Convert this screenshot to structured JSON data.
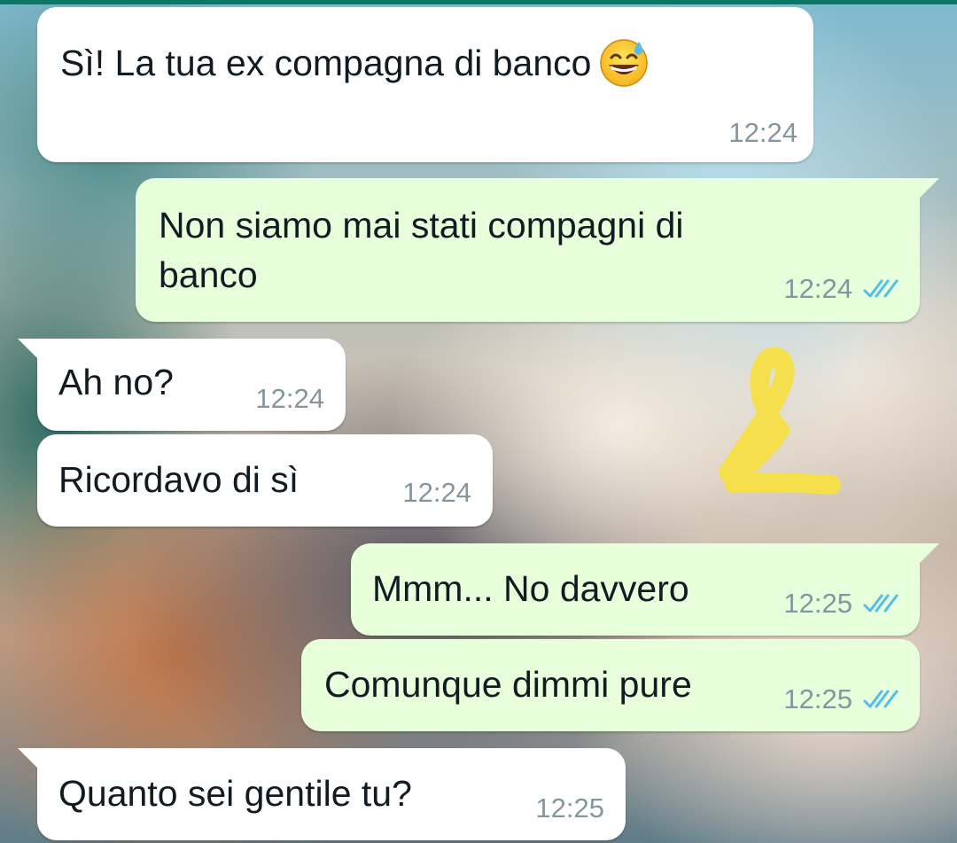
{
  "chat": {
    "messages": [
      {
        "text": "Sì! La tua ex compagna di banco",
        "emoji": "grinning-face-with-sweat",
        "time": "12:24",
        "direction": "incoming"
      },
      {
        "text_line1": "Non siamo mai stati compagni di",
        "text_line2": "banco",
        "time": "12:24",
        "direction": "outgoing",
        "status": "read"
      },
      {
        "text": "Ah no?",
        "time": "12:24",
        "direction": "incoming"
      },
      {
        "text": "Ricordavo di sì",
        "time": "12:24",
        "direction": "incoming"
      },
      {
        "text": "Mmm... No davvero",
        "time": "12:25",
        "direction": "outgoing",
        "status": "read"
      },
      {
        "text": "Comunque dimmi pure",
        "time": "12:25",
        "direction": "outgoing",
        "status": "read"
      },
      {
        "text": "Quanto sei gentile tu?",
        "time": "12:25",
        "direction": "incoming"
      }
    ]
  },
  "colors": {
    "incoming_bubble": "#ffffff",
    "outgoing_bubble": "#e7ffdb",
    "timestamp": "#8696a0",
    "read_ticks": "#53bdeb",
    "scribble": "#f5df4d"
  },
  "icons": {
    "read_receipt": "double-check-icon",
    "emoji": "grinning-face-with-sweat-icon"
  }
}
